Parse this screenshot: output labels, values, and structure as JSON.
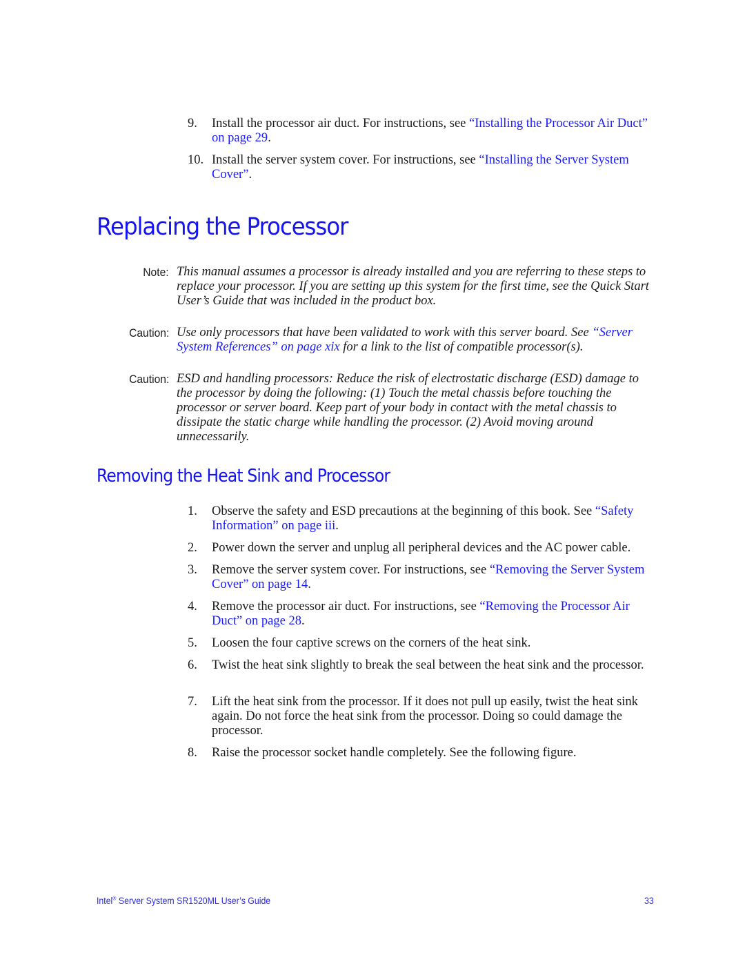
{
  "continued_steps": [
    {
      "num": "9.",
      "text": "Install the processor air duct. For instructions, see ",
      "link": "“Installing the Processor Air Duct” on page 29",
      "after": "."
    },
    {
      "num": "10.",
      "text": "Install the server system cover. For instructions, see ",
      "link": "“Installing the Server System Cover”",
      "after": "."
    }
  ],
  "section_title": "Replacing the Processor",
  "admonitions": [
    {
      "label": "Note:",
      "text": "This manual assumes a processor is already installed and you are referring to these steps to replace your processor. If you are setting up this system for the first time, see the Quick Start User’s Guide that was included in the product box.",
      "link": "",
      "after": ""
    },
    {
      "label": "Caution:",
      "text": "Use only processors that have been validated to work with this server board. See ",
      "link": "“Server System References” on page xix",
      "after": " for a link to the list of compatible processor(s)."
    },
    {
      "label": "Caution:",
      "text": "ESD and handling processors: Reduce the risk of electrostatic discharge (ESD) damage to the processor by doing the following: (1) Touch the metal chassis before touching the processor or server board. Keep part of your body in contact with the metal chassis to dissipate the static charge while handling the processor. (2) Avoid moving around unnecessarily.",
      "link": "",
      "after": ""
    }
  ],
  "subsection_title": "Removing the Heat Sink and Processor",
  "steps": [
    {
      "num": "1.",
      "text": "Observe the safety and ESD precautions at the beginning of this book. See ",
      "link": "“Safety Information” on page iii",
      "after": "."
    },
    {
      "num": "2.",
      "text": "Power down the server and unplug all peripheral devices and the AC power cable.",
      "link": "",
      "after": ""
    },
    {
      "num": "3.",
      "text": "Remove the server system cover. For instructions, see ",
      "link": "“Removing the Server System Cover” on page 14",
      "after": "."
    },
    {
      "num": "4.",
      "text": "Remove the processor air duct. For instructions, see ",
      "link": "“Removing the Processor Air Duct” on page 28",
      "after": "."
    },
    {
      "num": "5.",
      "text": "Loosen the four captive screws on the corners of the heat sink.",
      "link": "",
      "after": ""
    },
    {
      "num": "6.",
      "text": "Twist the heat sink slightly to break the seal between the heat sink and the processor.",
      "link": "",
      "after": ""
    },
    {
      "num": "7.",
      "text": "Lift the heat sink from the processor. If it does not pull up easily, twist the heat sink again. Do not force the heat sink from the processor. Doing so could damage the processor.",
      "link": "",
      "after": ""
    },
    {
      "num": "8.",
      "text": "Raise the processor socket handle completely. See the following figure.",
      "link": "",
      "after": ""
    }
  ],
  "footer": {
    "brand": "Intel",
    "trademark": "®",
    "title": " Server System SR1520ML User’s Guide",
    "page_number": "33"
  }
}
